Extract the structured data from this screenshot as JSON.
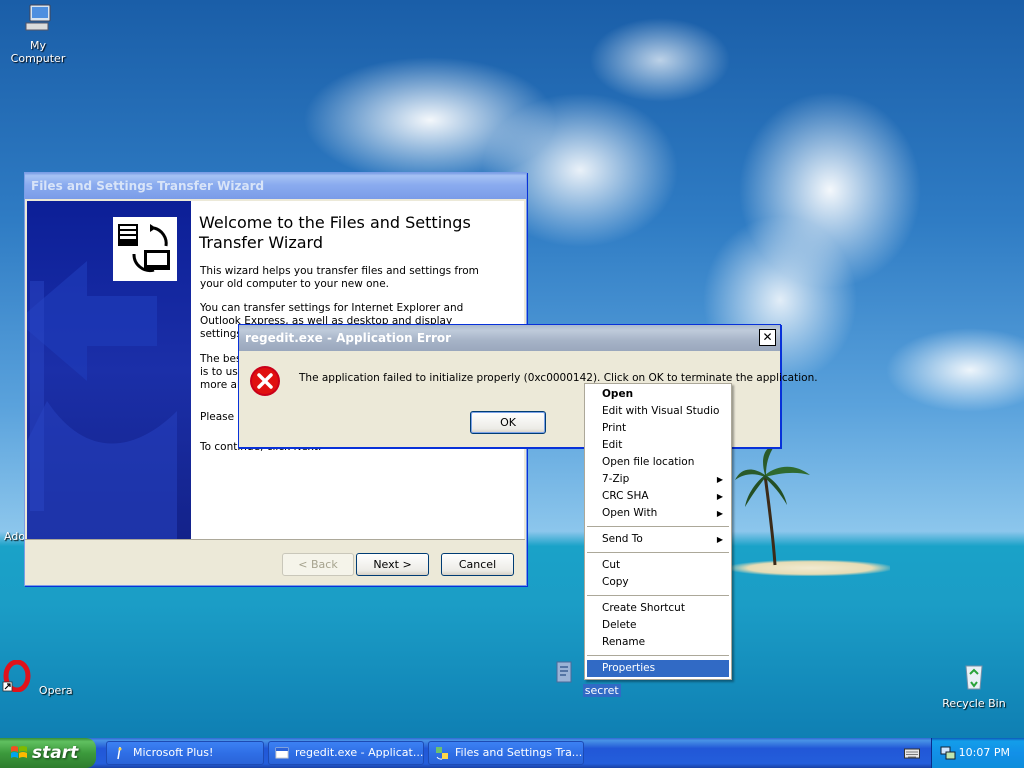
{
  "desktop": {
    "icons": {
      "my_computer": "My Computer",
      "opera": "Opera",
      "recycle_bin": "Recycle Bin",
      "secret": "secret"
    },
    "partial_label": "Ado"
  },
  "wizard": {
    "title": "Files and Settings Transfer Wizard",
    "heading": "Welcome to the Files and Settings Transfer Wizard",
    "para1": "This wizard helps you transfer files and settings from your old computer to your new one.",
    "para2": "You can transfer settings for Internet Explorer and Outlook Express, as well as desktop and display settings, dialup connec",
    "para3_fragment_a": "The bes",
    "para3_fragment_b": "is to use",
    "para3_fragment_c": "more ab",
    "para4_fragment": "Please",
    "para5": "To continue, click Next.",
    "buttons": {
      "back": "< Back",
      "next": "Next >",
      "cancel": "Cancel"
    }
  },
  "error_dialog": {
    "title": "regedit.exe - Application Error",
    "message": "The application failed to initialize properly (0xc0000142). Click on OK to terminate the application.",
    "ok": "OK",
    "close": "✕"
  },
  "context_menu": {
    "items": [
      {
        "label": "Open",
        "bold": true
      },
      {
        "label": "Edit with Visual Studio"
      },
      {
        "label": "Print"
      },
      {
        "label": "Edit"
      },
      {
        "label": "Open file location"
      },
      {
        "label": "7-Zip",
        "submenu": true
      },
      {
        "label": "CRC SHA",
        "submenu": true
      },
      {
        "label": "Open With",
        "submenu": true
      },
      {
        "label": "Send To",
        "submenu": true
      },
      {
        "label": "Cut"
      },
      {
        "label": "Copy"
      },
      {
        "label": "Create Shortcut"
      },
      {
        "label": "Delete"
      },
      {
        "label": "Rename"
      },
      {
        "label": "Properties",
        "highlighted": true
      }
    ],
    "arrow": "▶"
  },
  "taskbar": {
    "start": "start",
    "tasks": [
      {
        "label": "Microsoft Plus!"
      },
      {
        "label": "regedit.exe - Applicat..."
      },
      {
        "label": "Files and Settings Tra..."
      }
    ],
    "clock": "10:07 PM"
  },
  "colors": {
    "selection": "#316ac5",
    "title_active": "#0054e3",
    "error_red": "#e01010"
  }
}
